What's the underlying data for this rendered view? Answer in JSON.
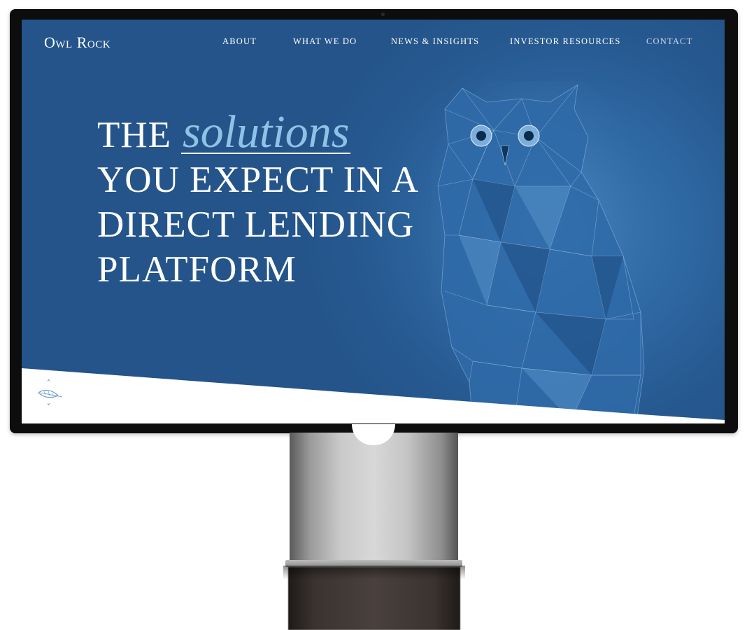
{
  "brand": {
    "logo_text": "Owl Rock"
  },
  "nav": {
    "items": [
      {
        "label": "ABOUT"
      },
      {
        "label": "WHAT WE DO"
      },
      {
        "label": "NEWS & INSIGHTS"
      },
      {
        "label": "INVESTOR RESOURCES"
      },
      {
        "label": "CONTACT"
      }
    ]
  },
  "hero": {
    "line1_prefix": "THE",
    "line1_accent": "solutions",
    "line2": "YOU EXPECT IN A",
    "line3": "DIRECT LENDING",
    "line4": "PLATFORM"
  },
  "scroll": {
    "up_icon": "chevron-up-icon",
    "down_icon": "chevron-down-icon",
    "up_glyph": "˄",
    "down_glyph": "˅",
    "feather_icon": "feather-icon"
  },
  "colors": {
    "screen_blue": "#2a5f99",
    "accent_light_blue": "#8fc3e6",
    "text_white": "#ffffff",
    "bezel": "#0d0d0d"
  }
}
